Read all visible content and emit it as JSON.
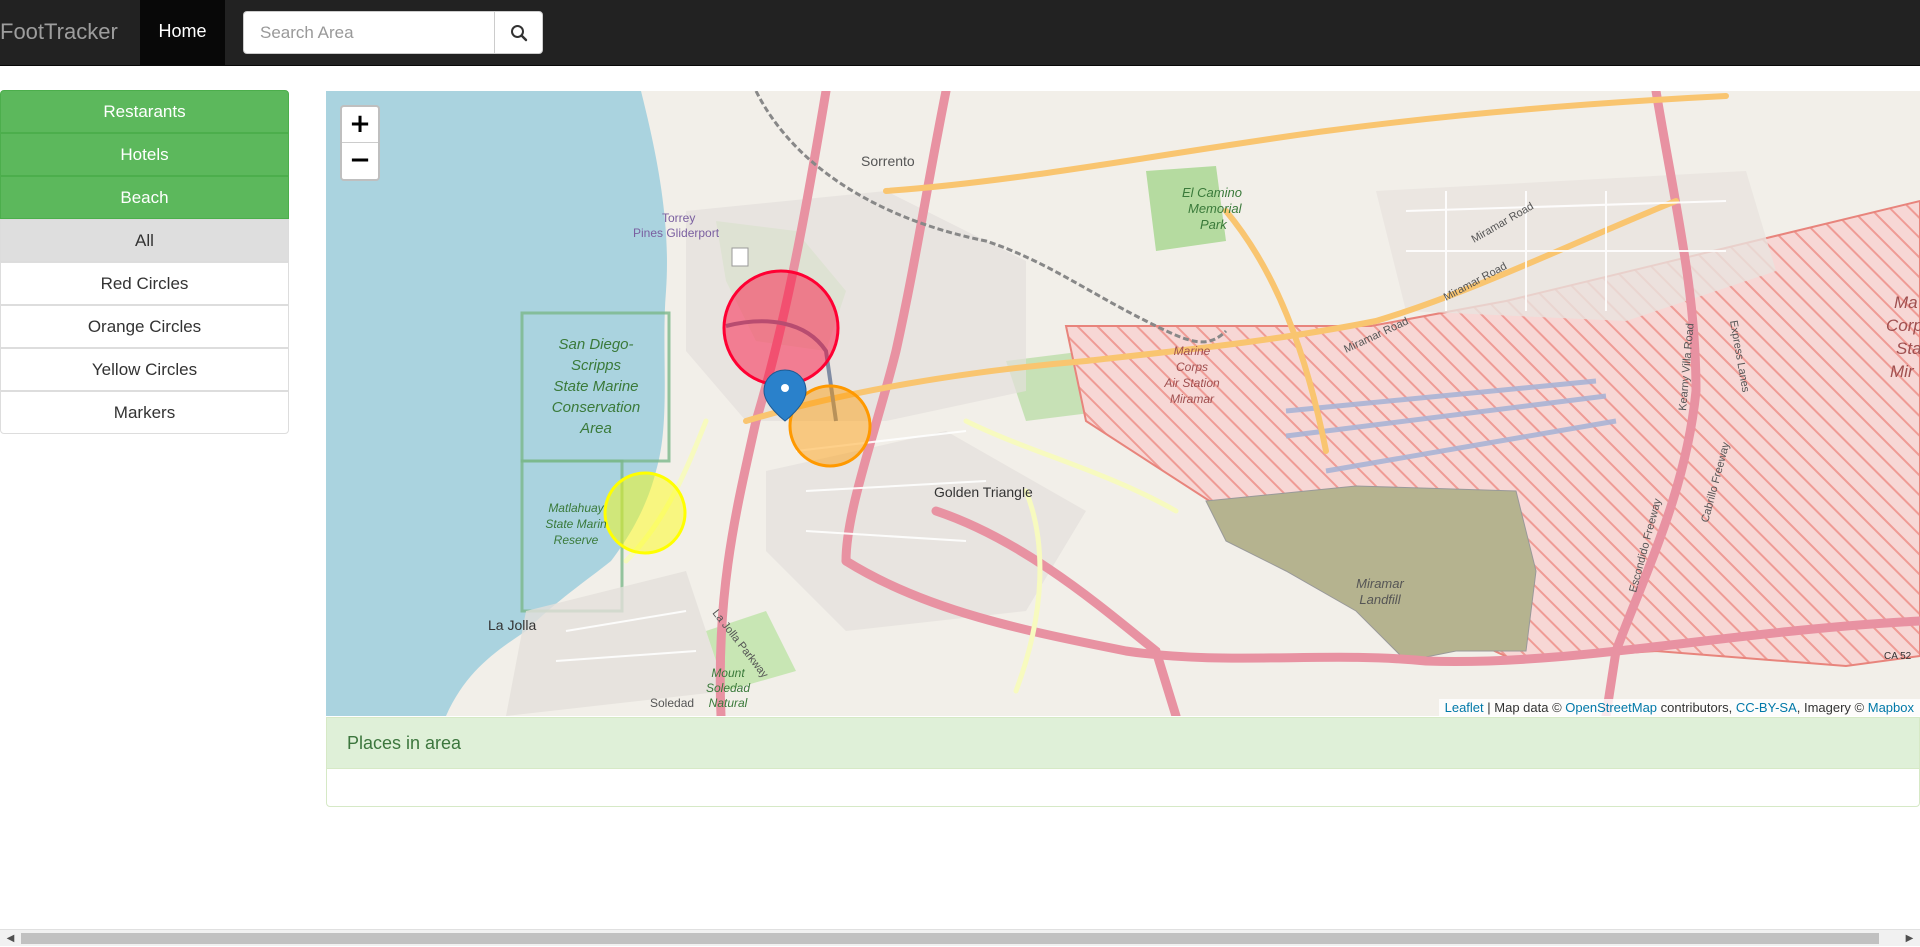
{
  "navbar": {
    "brand": "FootTracker",
    "home_label": "Home",
    "search_placeholder": "Search Area",
    "search_icon": "search-icon"
  },
  "sidebar": {
    "filter_buttons": [
      "Restarants",
      "Hotels",
      "Beach"
    ],
    "all_label": "All",
    "layer_buttons": [
      "Red Circles",
      "Orange Circles",
      "Yellow Circles",
      "Markers"
    ]
  },
  "map": {
    "zoom_in": "+",
    "zoom_out": "−",
    "attribution": {
      "leaflet": "Leaflet",
      "sep1": " | Map data © ",
      "osm": "OpenStreetMap",
      "sep2": " contributors, ",
      "license": "CC-BY-SA",
      "sep3": ", Imagery © ",
      "mapbox": "Mapbox"
    },
    "labels": {
      "sorrento": "Sorrento",
      "torrey1": "Torrey",
      "torrey2": "Pines Gliderport",
      "el_camino1": "El Camino",
      "el_camino2": "Memorial",
      "el_camino3": "Park",
      "sdscripps1": "San Diego-",
      "sdscripps2": "Scripps",
      "sdscripps3": "State Marine",
      "sdscripps4": "Conservation",
      "sdscripps5": "Area",
      "marine1": "Marine",
      "marine2": "Corps",
      "marine3": "Air Station",
      "marine4": "Miramar",
      "matla1": "Matlahuay",
      "matla2": "State Marin",
      "matla3": "Reserve",
      "golden": "Golden Triangle",
      "lajolla": "La Jolla",
      "landfill1": "Miramar",
      "landfill2": "Landfill",
      "mount1": "Mount",
      "mount2": "Soledad",
      "mount3": "Natural",
      "soledad": "Soledad",
      "miramar_road1": "Miramar Road",
      "miramar_road2": "Miramar Road",
      "miramar_road3": "Miramar Road",
      "lajolla_pkwy": "La Jolla Parkway",
      "kearny": "Kearny Villa Road",
      "express": "Express Lanes",
      "cabrillo": "Cabrillo Freeway",
      "escondido": "Escondido Freeway",
      "mc_right1": "Ma",
      "mc_right2": "Corp",
      "mc_right3": "Sta",
      "mc_right4": "Mir",
      "ca52": "CA 52"
    }
  },
  "panel": {
    "heading": "Places in area"
  },
  "colors": {
    "navbar_bg": "#222222",
    "brand": "#9d9d9d",
    "success": "#5cb85c",
    "panel_head_bg": "#dff0d8",
    "panel_head_text": "#3c763d",
    "red_circle": "#f03",
    "orange_circle": "#ff9900",
    "yellow_circle": "#ffff00",
    "marker": "#2a81cb"
  }
}
